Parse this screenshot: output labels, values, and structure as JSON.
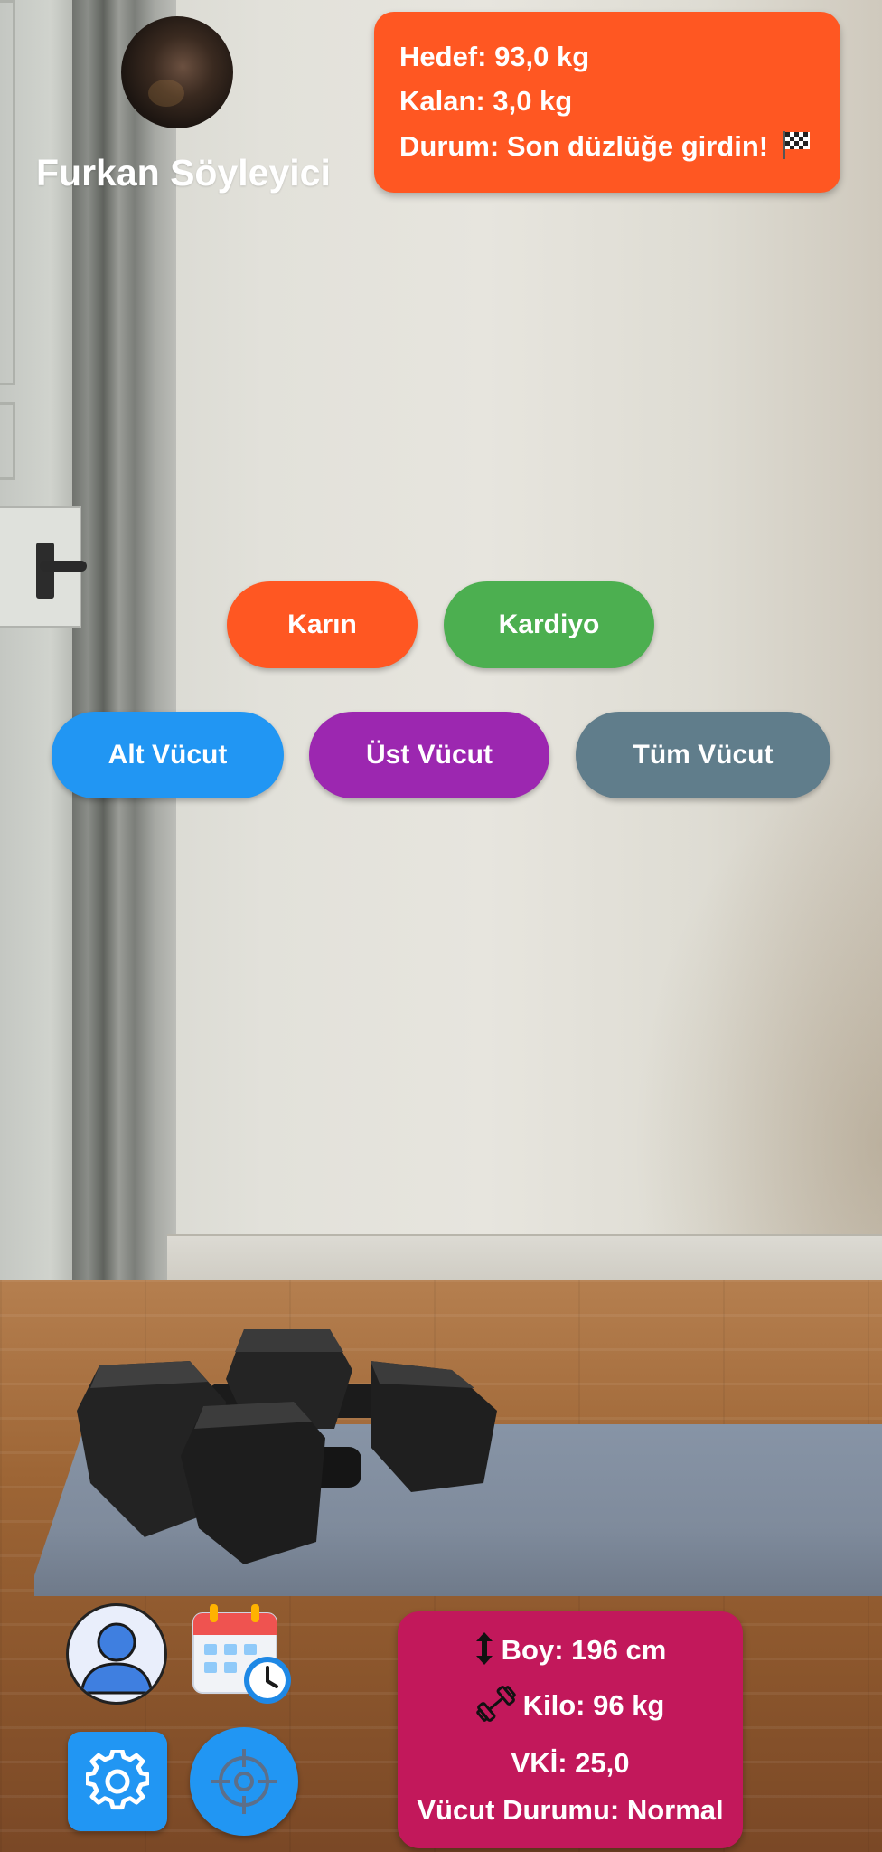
{
  "profile": {
    "user_name": "Furkan Söyleyici"
  },
  "goal_card": {
    "target_line": "Hedef: 93,0 kg",
    "remaining_line": "Kalan: 3,0 kg",
    "status_line": "Durum: Son düzlüğe girdin!",
    "status_icon": "checkered-flag-icon",
    "background_color": "#ff5722"
  },
  "categories": [
    {
      "label": "Karın",
      "color": "#ff5722"
    },
    {
      "label": "Kardiyo",
      "color": "#4caf50"
    },
    {
      "label": "Alt Vücut",
      "color": "#2196f3"
    },
    {
      "label": "Üst Vücut",
      "color": "#9c27b0"
    },
    {
      "label": "Tüm Vücut",
      "color": "#607d8b"
    }
  ],
  "bottom_nav": {
    "profile_icon": "user-profile-icon",
    "calendar_icon": "calendar-clock-icon",
    "settings_icon": "gear-icon",
    "target_icon": "crosshair-target-icon",
    "accent_color": "#2196f3"
  },
  "stats_card": {
    "height_line": "Boy: 196 cm",
    "weight_line": "Kilo: 96 kg",
    "bmi_line": "VKİ: 25,0",
    "body_status_line": "Vücut Durumu: Normal",
    "height_icon": "vertical-arrows-icon",
    "weight_icon": "dumbbell-icon",
    "background_color": "#c2185b"
  }
}
